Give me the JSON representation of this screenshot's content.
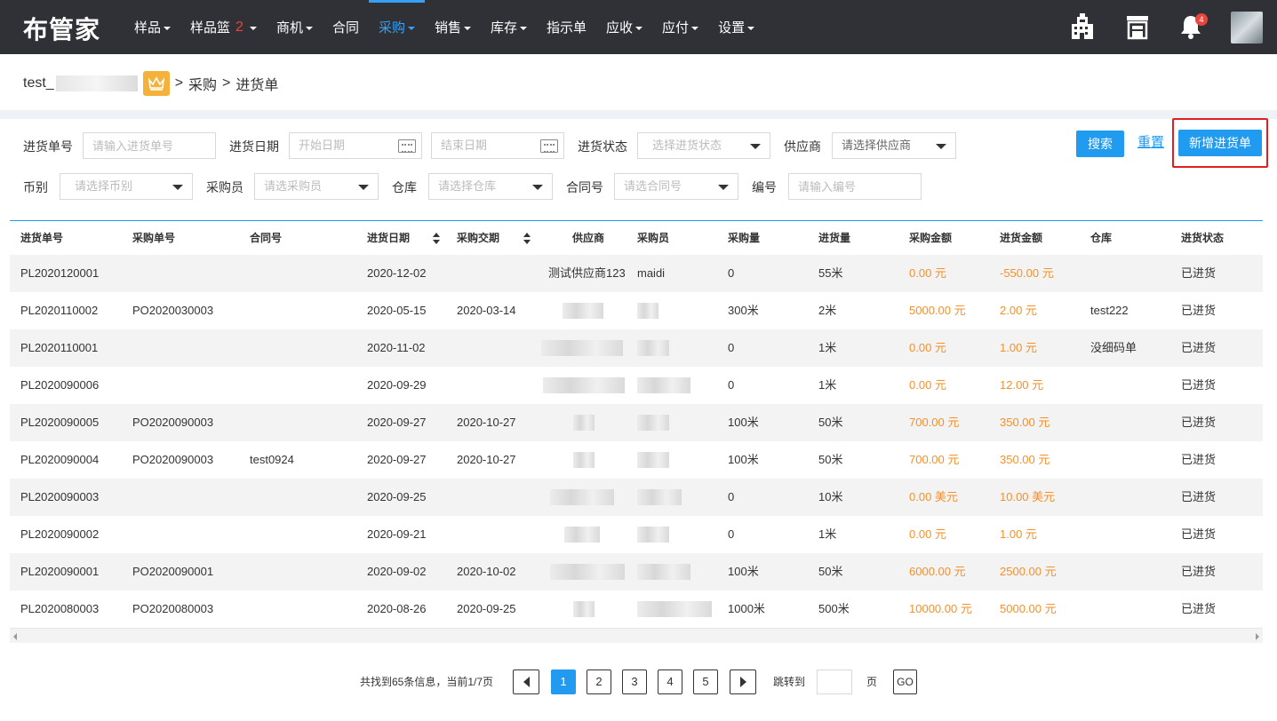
{
  "app": {
    "logo": "布管家"
  },
  "nav": {
    "items": [
      {
        "label": "样品",
        "dropdown": true
      },
      {
        "label": "样品篮",
        "badge": "2",
        "dropdown": true
      },
      {
        "label": "商机",
        "dropdown": true
      },
      {
        "label": "合同",
        "dropdown": false
      },
      {
        "label": "采购",
        "dropdown": true,
        "active": true
      },
      {
        "label": "销售",
        "dropdown": true
      },
      {
        "label": "库存",
        "dropdown": true
      },
      {
        "label": "指示单",
        "dropdown": false
      },
      {
        "label": "应收",
        "dropdown": true
      },
      {
        "label": "应付",
        "dropdown": true
      },
      {
        "label": "设置",
        "dropdown": true
      }
    ],
    "notification_count": "4"
  },
  "breadcrumb": {
    "account": "test_",
    "sep1": ">",
    "level1": "采购",
    "sep2": ">",
    "level2": "进货单"
  },
  "filters": {
    "order_no_label": "进货单号",
    "order_no_placeholder": "请输入进货单号",
    "date_label": "进货日期",
    "start_placeholder": "开始日期",
    "end_placeholder": "结束日期",
    "status_label": "进货状态",
    "status_placeholder": "选择进货状态",
    "supplier_label": "供应商",
    "supplier_placeholder": "请选择供应商",
    "currency_label": "币别",
    "currency_placeholder": "请选择币别",
    "buyer_label": "采购员",
    "buyer_placeholder": "请选采购员",
    "warehouse_label": "仓库",
    "warehouse_placeholder": "请选择仓库",
    "contract_label": "合同号",
    "contract_placeholder": "请选合同号",
    "code_label": "编号",
    "code_placeholder": "请输入编号",
    "search_button": "搜索",
    "reset_link": "重置",
    "add_button": "新增进货单"
  },
  "table": {
    "columns": [
      "进货单号",
      "采购单号",
      "合同号",
      "进货日期",
      "采购交期",
      "供应商",
      "采购员",
      "采购量",
      "进货量",
      "采购金额",
      "进货金额",
      "仓库",
      "进货状态"
    ],
    "rows": [
      {
        "order": "PL2020120001",
        "po": "",
        "contract": "",
        "date": "2020-12-02",
        "delivery": "",
        "supplier": "测试供应商123",
        "buyer": "maidi",
        "pqty": "0",
        "qty": "55米",
        "pamt": "0.00 元",
        "amt": "-550.00 元",
        "wh": "",
        "status": "已进货"
      },
      {
        "order": "PL2020110002",
        "po": "PO2020030003",
        "contract": "",
        "date": "2020-05-15",
        "delivery": "2020-03-14",
        "supplier": "",
        "buyer": "",
        "pqty": "300米",
        "qty": "2米",
        "pamt": "5000.00 元",
        "amt": "2.00 元",
        "wh": "test222",
        "status": "已进货"
      },
      {
        "order": "PL2020110001",
        "po": "",
        "contract": "",
        "date": "2020-11-02",
        "delivery": "",
        "supplier": "",
        "buyer": "",
        "pqty": "0",
        "qty": "1米",
        "pamt": "0.00 元",
        "amt": "1.00 元",
        "wh": "没细码单",
        "status": "已进货"
      },
      {
        "order": "PL2020090006",
        "po": "",
        "contract": "",
        "date": "2020-09-29",
        "delivery": "",
        "supplier": "",
        "buyer": "",
        "pqty": "0",
        "qty": "1米",
        "pamt": "0.00 元",
        "amt": "12.00 元",
        "wh": "",
        "status": "已进货"
      },
      {
        "order": "PL2020090005",
        "po": "PO2020090003",
        "contract": "",
        "date": "2020-09-27",
        "delivery": "2020-10-27",
        "supplier": "",
        "buyer": "",
        "pqty": "100米",
        "qty": "50米",
        "pamt": "700.00 元",
        "amt": "350.00 元",
        "wh": "",
        "status": "已进货"
      },
      {
        "order": "PL2020090004",
        "po": "PO2020090003",
        "contract": "test0924",
        "date": "2020-09-27",
        "delivery": "2020-10-27",
        "supplier": "",
        "buyer": "",
        "pqty": "100米",
        "qty": "50米",
        "pamt": "700.00 元",
        "amt": "350.00 元",
        "wh": "",
        "status": "已进货"
      },
      {
        "order": "PL2020090003",
        "po": "",
        "contract": "",
        "date": "2020-09-25",
        "delivery": "",
        "supplier": "",
        "buyer": "",
        "pqty": "0",
        "qty": "10米",
        "pamt": "0.00 美元",
        "amt": "10.00 美元",
        "wh": "",
        "status": "已进货"
      },
      {
        "order": "PL2020090002",
        "po": "",
        "contract": "",
        "date": "2020-09-21",
        "delivery": "",
        "supplier": "",
        "buyer": "",
        "pqty": "0",
        "qty": "1米",
        "pamt": "0.00 元",
        "amt": "1.00 元",
        "wh": "",
        "status": "已进货"
      },
      {
        "order": "PL2020090001",
        "po": "PO2020090001",
        "contract": "",
        "date": "2020-09-02",
        "delivery": "2020-10-02",
        "supplier": "",
        "buyer": "",
        "pqty": "100米",
        "qty": "50米",
        "pamt": "6000.00 元",
        "amt": "2500.00 元",
        "wh": "",
        "status": "已进货"
      },
      {
        "order": "PL2020080003",
        "po": "PO2020080003",
        "contract": "",
        "date": "2020-08-26",
        "delivery": "2020-09-25",
        "supplier": "",
        "buyer": "",
        "pqty": "1000米",
        "qty": "500米",
        "pamt": "10000.00 元",
        "amt": "5000.00 元",
        "wh": "",
        "status": "已进货"
      }
    ]
  },
  "pagination": {
    "info": "共找到65条信息，当前1/7页",
    "pages": [
      "1",
      "2",
      "3",
      "4",
      "5"
    ],
    "current": "1",
    "jump_label": "跳转到",
    "page_unit": "页",
    "go_button": "GO"
  },
  "colors": {
    "accent": "#209bef",
    "orange": "#f5902a",
    "nav_bg": "#2f3136",
    "highlight": "#e02020"
  }
}
